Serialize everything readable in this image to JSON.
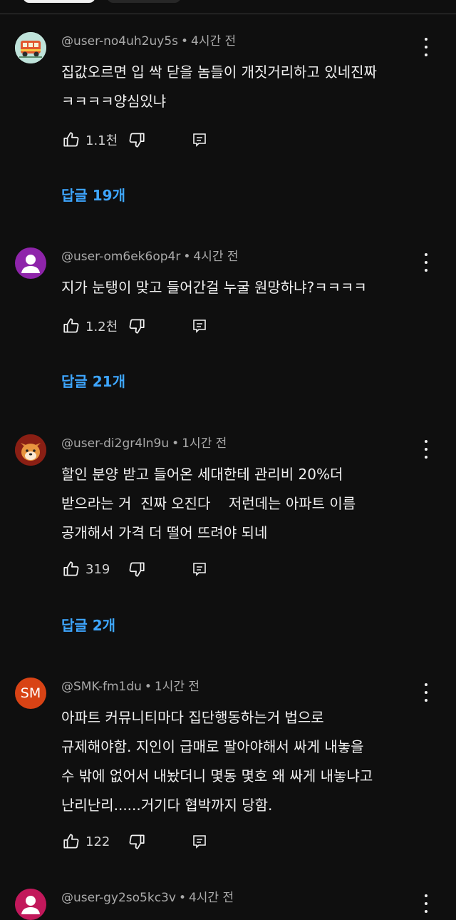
{
  "comments": [
    {
      "user": "@user-no4uh2uy5s",
      "time": "4시간 전",
      "lines": [
        "집값오르면 입 싹 닫을 놈들이 개짓거리하고 있네진짜",
        "ㅋㅋㅋㅋ양심있냐"
      ],
      "likes": "1.1천",
      "replies": "답글 19개",
      "avatar": "bus-avatar"
    },
    {
      "user": "@user-om6ek6op4r",
      "time": "4시간 전",
      "lines": [
        "지가 눈탱이 맞고 들어간걸 누굴 원망하냐?ㅋㅋㅋㅋ"
      ],
      "likes": "1.2천",
      "replies": "답글 21개",
      "avatar": "default-person-avatar",
      "avatar_color": "#8e24aa"
    },
    {
      "user": "@user-di2gr4ln9u",
      "time": "1시간 전",
      "lines": [
        "할인 분양 받고 들어온 세대한테 관리비 20%더",
        "받으라는 거  진짜 오진다    저런데는 아파트 이름",
        "공개해서 가격 더 떨어 뜨려야 되네"
      ],
      "likes": "319",
      "replies": "답글 2개",
      "avatar": "dog-avatar"
    },
    {
      "user": "@SMK-fm1du",
      "time": "1시간 전",
      "lines": [
        "아파트 커뮤니티마다 집단행동하는거 법으로",
        "규제해야함. 지인이 급매로 팔아야해서 싸게 내놓을",
        "수 밖에 없어서 내놨더니 몇동 몇호 왜 싸게 내놓냐고",
        "난리난리......거기다 협박까지 당함."
      ],
      "likes": "122",
      "avatar_text": "SM",
      "avatar_color": "#d84315"
    },
    {
      "user": "@user-gy2so5kc3v",
      "time": "4시간 전",
      "avatar": "default-person-avatar",
      "avatar_color": "#c2185b"
    }
  ],
  "separator": "•"
}
